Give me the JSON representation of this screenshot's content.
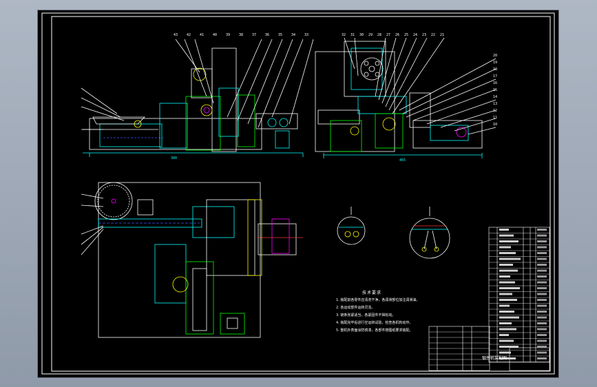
{
  "drawing": {
    "notes_title": "技术要求",
    "notes": [
      "1. 装配前各零件应清洗干净，各润滑部位加注润滑油。",
      "2. 各运动部件运转灵活。",
      "3. 链条张紧适当，各紧固件不得松动。",
      "4. 装配完毕后进行空运转试验，检查各机构动作。",
      "5. 整机外表面涂防锈漆，各部件按图纸要求装配。"
    ],
    "title_block_name": "锻件机装配图",
    "dim_labels": [
      "380",
      "465",
      "1100",
      "560"
    ],
    "balloons_left_top": [
      "43",
      "42",
      "41",
      "40",
      "39",
      "38",
      "37",
      "36",
      "35",
      "34",
      "33"
    ],
    "balloons_right_top": [
      "32",
      "31",
      "30",
      "29",
      "28",
      "27",
      "26",
      "25",
      "24",
      "23",
      "22",
      "21"
    ],
    "balloons_right_side": [
      "20",
      "19",
      "18",
      "17",
      "16",
      "15",
      "14",
      "13",
      "12",
      "11",
      "10"
    ],
    "colors": {
      "background": "#000000",
      "line_white": "#ffffff",
      "line_cyan": "#00ffff",
      "line_green": "#00ff00",
      "line_yellow": "#ffff00",
      "line_magenta": "#ff00ff",
      "line_red": "#ff3333",
      "line_blue": "#3a5cff"
    }
  }
}
